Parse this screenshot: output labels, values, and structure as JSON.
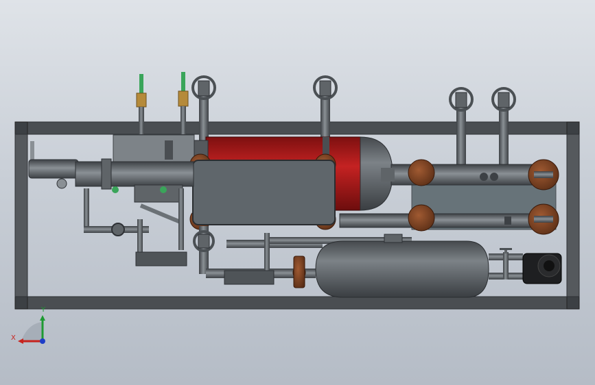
{
  "viewport": {
    "background_top": "#dfe3e8",
    "background_bottom": "#b5bcc6"
  },
  "colors": {
    "frame": "#4a4e52",
    "frame_edge": "#2e3135",
    "steel": "#5f6468",
    "steel_light": "#8a9095",
    "steel_dark": "#3d4145",
    "vessel_red": "#b81c1c",
    "flange_rust": "#7a4224",
    "panel_glass": "#5d6a70",
    "valve_green": "#3aa55a",
    "fitting_brass": "#b58a3a",
    "motor_black": "#1e1f21"
  },
  "components": {
    "frame": "skid-frame",
    "red_vessel": "separator-vessel",
    "lower_vessel": "receiver-tank",
    "heat_exchanger": "heat-exchanger",
    "pump": "pump-motor"
  },
  "triad": {
    "x_label": "X",
    "y_label": "Y",
    "x_color": "#c8241e",
    "y_color": "#1e9a32",
    "z_color": "#1e3ec8"
  }
}
